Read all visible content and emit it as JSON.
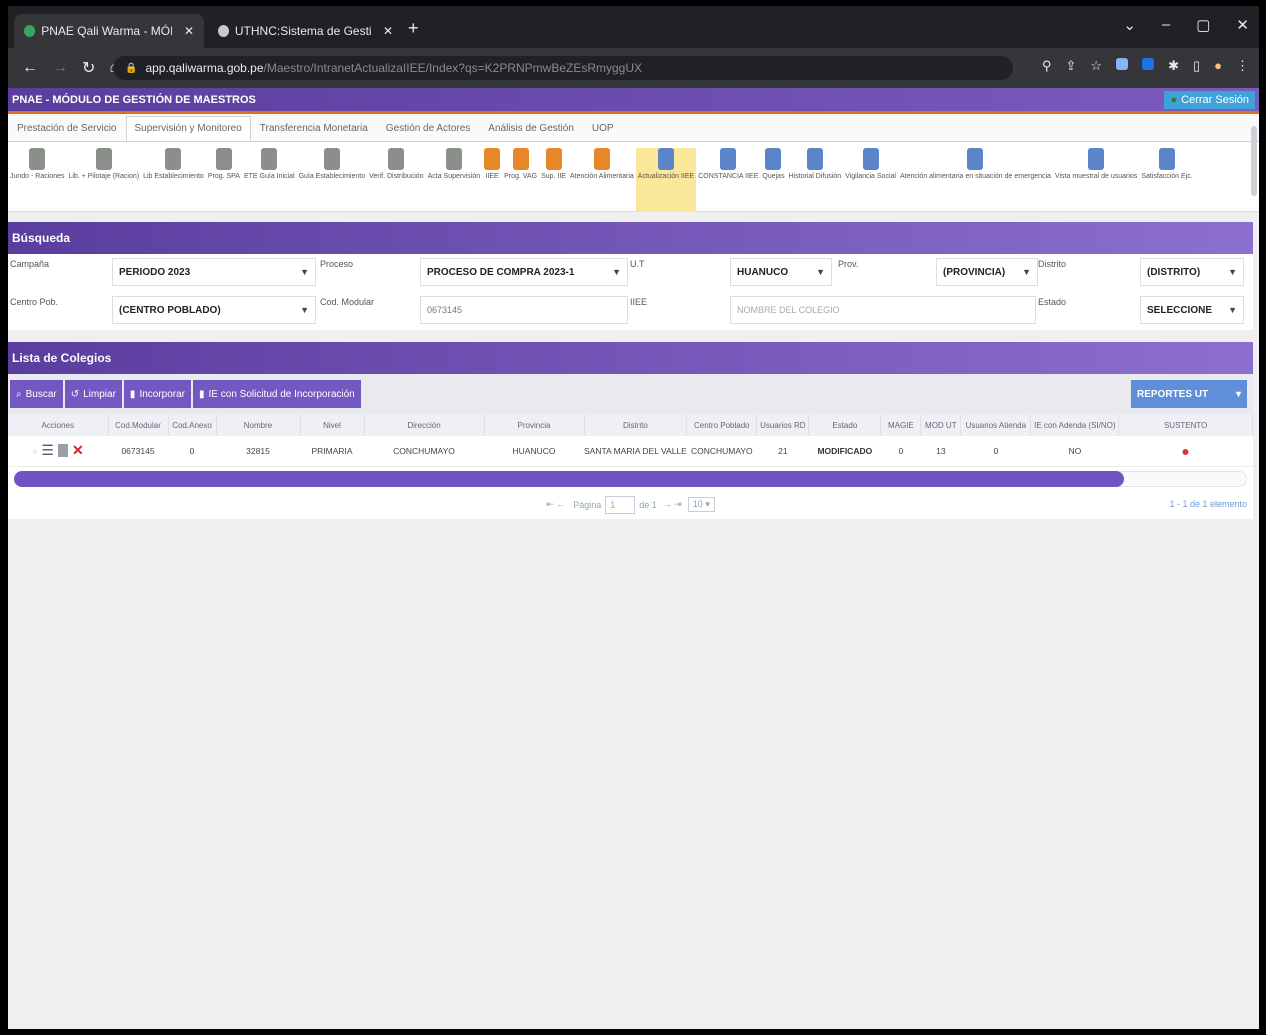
{
  "browser": {
    "tabs": [
      {
        "label": "PNAE Qali Warma - MÓDULO D",
        "active": true,
        "color": "#3ba55d"
      },
      {
        "label": "UTHNC:Sistema de Gestión Do",
        "active": false,
        "color": "#c8c8c8"
      }
    ],
    "url_host": "app.qaliwarma.gob.pe",
    "url_path": "/Maestro/IntranetActualizaIIEE/Index?qs=K2PRNPmwBeZEsRmyggUX"
  },
  "app": {
    "title": "PNAE - MÓDULO DE GESTIÓN DE MAESTROS",
    "logout_label": "Cerrar Sesión"
  },
  "menu_tabs": [
    "Prestación de Servicio",
    "Supervisión y Monitoreo",
    "Transferencia Monetaria",
    "Gestión de Actores",
    "Análisis de Gestión",
    "UOP"
  ],
  "icon_bar": [
    {
      "label": "Jundo - Raciones",
      "type": "doc"
    },
    {
      "label": "Lib. + Pilotaje (Racion)",
      "type": "doc"
    },
    {
      "label": "Lib Establecimiento",
      "type": "doc"
    },
    {
      "label": "Prog. SPA",
      "type": "doc"
    },
    {
      "label": "ETE Guía Inicial",
      "type": "doc"
    },
    {
      "label": "Guía Establecimiento",
      "type": "doc"
    },
    {
      "label": "Verif. Distribución",
      "type": "doc"
    },
    {
      "label": "Acta Supervisión",
      "type": "doc"
    },
    {
      "label": "IIEE",
      "type": "hand"
    },
    {
      "label": "Prog. VAG",
      "type": "hand"
    },
    {
      "label": "Sup. IIE",
      "type": "hand"
    },
    {
      "label": "Atención Alimentaria",
      "type": "hand"
    },
    {
      "label": "Actualización IIEE",
      "type": "person",
      "selected": true
    },
    {
      "label": "CONSTANCIA IIEE",
      "type": "person"
    },
    {
      "label": "Quejas",
      "type": "person"
    },
    {
      "label": "Historial Difusión",
      "type": "person"
    },
    {
      "label": "Vigilancia Social",
      "type": "person"
    },
    {
      "label": "Atención alimentaria en situación de emergencia",
      "type": "person"
    },
    {
      "label": "Vista muestral de usuarios",
      "type": "person"
    },
    {
      "label": "Satisfacción Ejc.",
      "type": "person"
    }
  ],
  "busqueda": {
    "title": "Búsqueda",
    "campania_label": "Campaña",
    "campania_value": "PERIODO 2023",
    "proceso_label": "Proceso",
    "proceso_value": "PROCESO DE COMPRA 2023-1",
    "ut_label": "U.T",
    "ut_value": "HUANUCO",
    "prov_label": "Prov.",
    "prov_value": "(PROVINCIA)",
    "distrito_label": "Distrito",
    "distrito_value": "(DISTRITO)",
    "centro_label": "Centro Pob.",
    "centro_value": "(CENTRO POBLADO)",
    "codmod_label": "Cod. Modular",
    "codmod_value": "0673145",
    "iiee_label": "IIEE",
    "iiee_placeholder": "NOMBRE DEL COLEGIO",
    "estado_label": "Estado",
    "estado_value": "SELECCIONE"
  },
  "lista": {
    "title": "Lista de Colegios",
    "buttons": {
      "buscar": "Buscar",
      "limpiar": "Limpiar",
      "incorporar": "Incorporar",
      "solicitud": "IE con Solicitud de Incorporación"
    },
    "reportes_label": "REPORTES UT",
    "columns": [
      "Acciones",
      "Cod.Modular",
      "Cod.Anexo",
      "Nombre",
      "Nivel",
      "Dirección",
      "Provincia",
      "Distrito",
      "Centro Poblado",
      "Usuarios RD",
      "Estado",
      "MAGIE",
      "MOD UT",
      "Usuarios Atienda",
      "IE con Adenda (SI/NO)",
      "SUSTENTO"
    ],
    "rows": [
      {
        "codmod": "0673145",
        "codanexo": "0",
        "nombre": "32815",
        "nivel": "PRIMARIA",
        "direccion": "CONCHUMAYO",
        "provincia": "HUANUCO",
        "distrito": "SANTA MARIA DEL VALLE",
        "centro": "CONCHUMAYO",
        "usuarios_rd": "21",
        "estado": "MODIFICADO",
        "magie": "0",
        "mod_ut": "13",
        "usuarios_atienda": "0",
        "adenda": "NO"
      }
    ],
    "scroll_fraction": 0.9,
    "pager": {
      "page_label": "Página",
      "page_value": "1",
      "of_label": "de 1",
      "page_size": "10",
      "total_label": "1 - 1 de 1 elemento"
    }
  }
}
